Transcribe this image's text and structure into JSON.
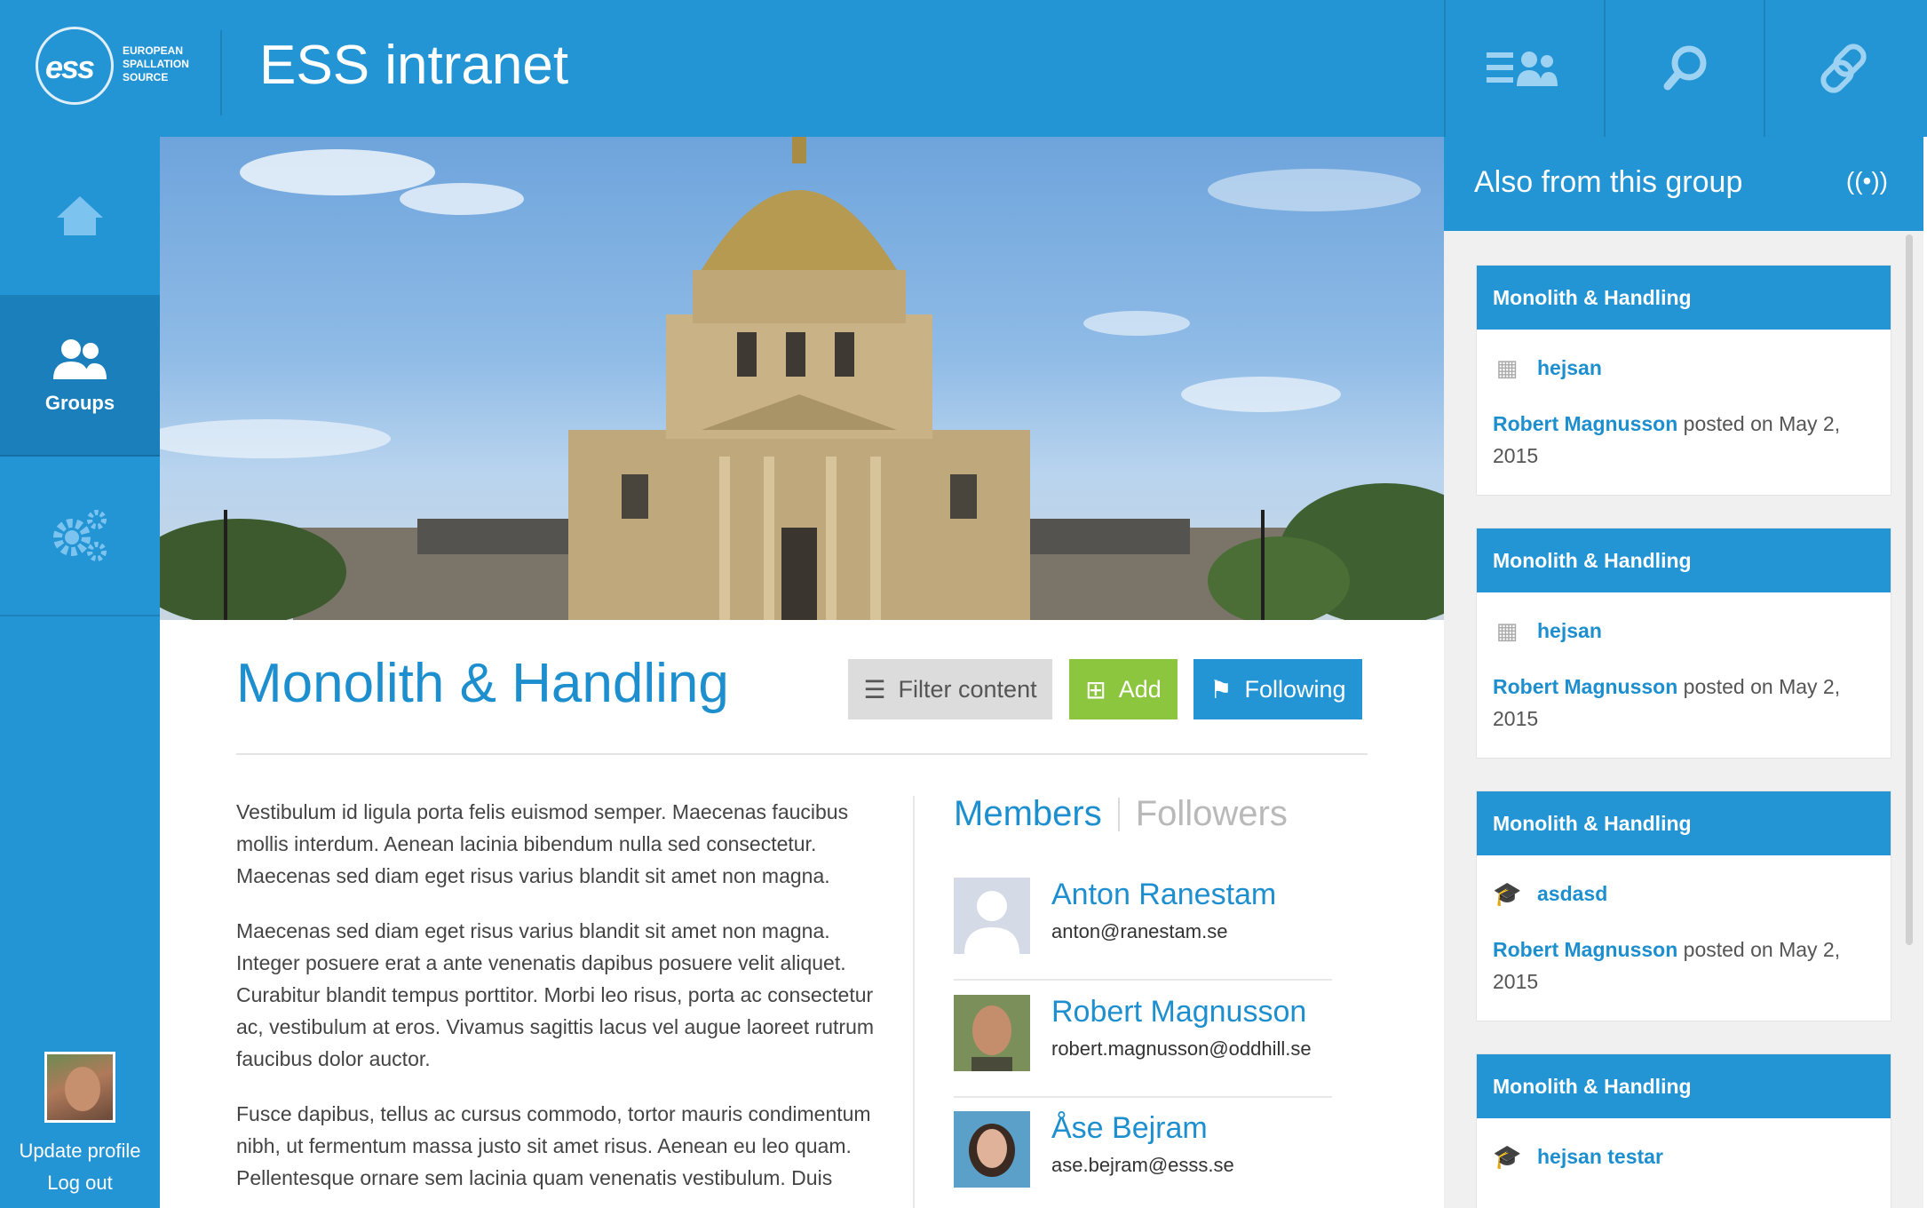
{
  "header": {
    "logo_mark": "ess",
    "logo_line1": "EUROPEAN",
    "logo_line2": "SPALLATION",
    "logo_line3": "SOURCE",
    "title": "ESS intranet",
    "buttons": [
      {
        "icon": "menu-people-icon"
      },
      {
        "icon": "search-icon"
      },
      {
        "icon": "link-icon"
      }
    ]
  },
  "nav": {
    "items": [
      {
        "icon": "home-icon",
        "label": ""
      },
      {
        "icon": "groups-icon",
        "label": "Groups",
        "active": true
      },
      {
        "icon": "gears-icon",
        "label": ""
      }
    ],
    "profile": {
      "update_label": "Update profile",
      "logout_label": "Log out"
    }
  },
  "group": {
    "title": "Monolith & Handling",
    "filter_label": "Filter content",
    "add_label": "Add",
    "following_label": "Following",
    "description": [
      "Vestibulum id ligula porta felis euismod semper. Maecenas faucibus mollis interdum. Aenean lacinia bibendum nulla sed consectetur. Maecenas sed diam eget risus varius blandit sit amet non magna.",
      "Maecenas sed diam eget risus varius blandit sit amet non magna. Integer posuere erat a ante venenatis dapibus posuere velit aliquet. Curabitur blandit tempus porttitor. Morbi leo risus, porta ac consectetur ac, vestibulum at eros. Vivamus sagittis lacus vel augue laoreet rutrum faucibus dolor auctor.",
      "Fusce dapibus, tellus ac cursus commodo, tortor mauris condimentum nibh, ut fermentum massa justo sit amet risus. Aenean eu leo quam. Pellentesque ornare sem lacinia quam venenatis vestibulum. Duis"
    ]
  },
  "members": {
    "tab_members": "Members",
    "tab_followers": "Followers",
    "list": [
      {
        "name": "Anton Ranestam",
        "email": "anton@ranestam.se"
      },
      {
        "name": "Robert Magnusson",
        "email": "robert.magnusson@oddhill.se"
      },
      {
        "name": "Åse Bejram",
        "email": "ase.bejram@esss.se"
      }
    ]
  },
  "sidebar": {
    "title": "Also from this group",
    "cards": [
      {
        "group": "Monolith & Handling",
        "icon": "calendar-icon",
        "title": "hejsan",
        "author": "Robert Magnusson",
        "posted": "posted on May 2, 2015"
      },
      {
        "group": "Monolith & Handling",
        "icon": "calendar-icon",
        "title": "hejsan",
        "author": "Robert Magnusson",
        "posted": "posted on May 2, 2015"
      },
      {
        "group": "Monolith & Handling",
        "icon": "graduation-cap-icon",
        "title": "asdasd",
        "author": "Robert Magnusson",
        "posted": "posted on May 2, 2015"
      },
      {
        "group": "Monolith & Handling",
        "icon": "graduation-cap-icon",
        "title": "hejsan testar",
        "author": "",
        "posted": ""
      }
    ]
  },
  "colors": {
    "brand": "#2394d4",
    "brand_dark": "#1a7fbb",
    "link": "#1d8fcf",
    "add_green": "#8cc63e"
  }
}
